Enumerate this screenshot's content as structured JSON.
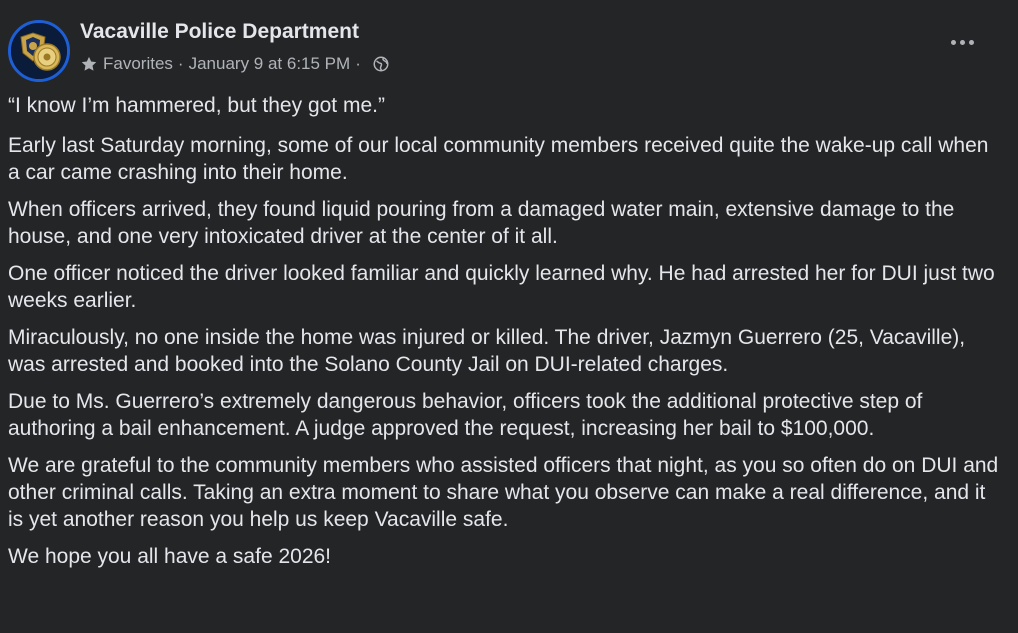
{
  "post": {
    "author": "Vacaville Police Department",
    "audience": "Favorites",
    "timestamp": "January 9 at 6:15 PM",
    "separator": "·",
    "icons": {
      "avatar": "police-badge-avatar",
      "audience": "star-icon",
      "privacy": "globe-icon",
      "menu": "more-options-icon"
    },
    "paragraphs": [
      "“I know I’m hammered, but they got me.”",
      "Early last Saturday morning, some of our local community members received quite the wake-up call when a car came crashing into their home.",
      "When officers arrived, they found liquid pouring from a damaged water main, extensive damage to the house, and one very intoxicated driver at the center of it all.",
      "One officer noticed the driver looked familiar and quickly learned why. He had arrested her for DUI just two weeks earlier.",
      "Miraculously, no one inside the home was injured or killed. The driver, Jazmyn Guerrero (25, Vacaville), was arrested and booked into the Solano County Jail on DUI-related charges.",
      "Due to Ms. Guerrero’s extremely dangerous behavior, officers took the additional protective step of authoring a bail enhancement. A judge approved the request, increasing her bail to $100,000.",
      "We are grateful to the community members who assisted officers that night, as you so often do on DUI and other criminal calls. Taking an extra moment to share what you observe can make a real difference, and it is yet another reason you help us keep Vacaville safe.",
      "We hope you all have a safe 2026!"
    ]
  },
  "colors": {
    "background": "#242526",
    "primary_text": "#e4e6eb",
    "secondary_text": "#b0b3b8",
    "avatar_ring": "#1e5fd6"
  }
}
